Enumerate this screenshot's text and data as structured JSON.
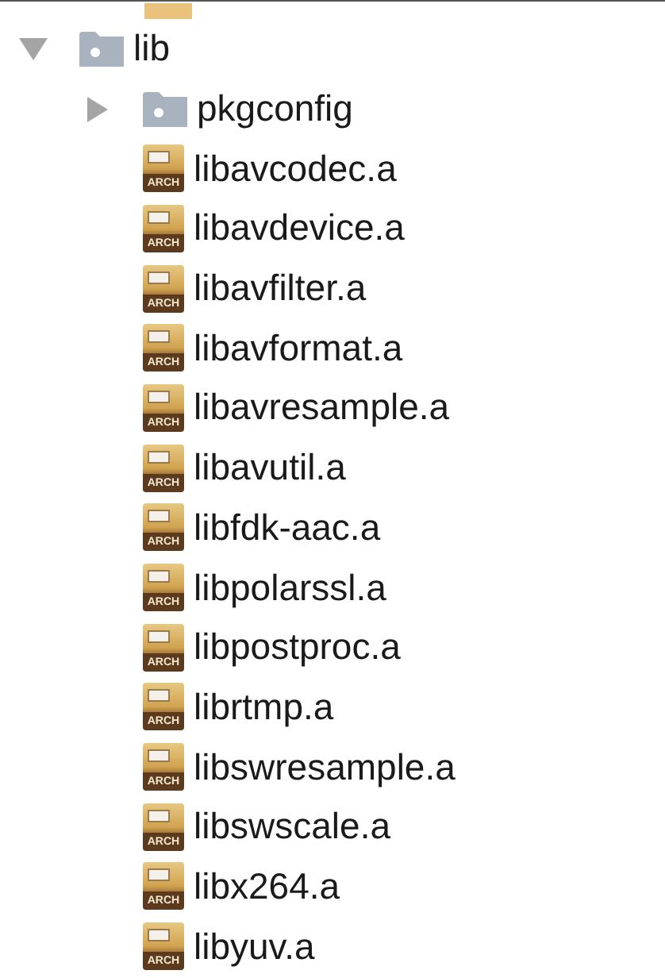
{
  "tree": [
    {
      "kind": "folder",
      "label": "lib",
      "expanded": true,
      "children": [
        {
          "kind": "folder",
          "label": "pkgconfig",
          "expanded": false
        },
        {
          "kind": "file",
          "label": "libavcodec.a",
          "icon_text": "ARCH"
        },
        {
          "kind": "file",
          "label": "libavdevice.a",
          "icon_text": "ARCH"
        },
        {
          "kind": "file",
          "label": "libavfilter.a",
          "icon_text": "ARCH"
        },
        {
          "kind": "file",
          "label": "libavformat.a",
          "icon_text": "ARCH"
        },
        {
          "kind": "file",
          "label": "libavresample.a",
          "icon_text": "ARCH"
        },
        {
          "kind": "file",
          "label": "libavutil.a",
          "icon_text": "ARCH"
        },
        {
          "kind": "file",
          "label": "libfdk-aac.a",
          "icon_text": "ARCH"
        },
        {
          "kind": "file",
          "label": "libpolarssl.a",
          "icon_text": "ARCH"
        },
        {
          "kind": "file",
          "label": "libpostproc.a",
          "icon_text": "ARCH"
        },
        {
          "kind": "file",
          "label": "librtmp.a",
          "icon_text": "ARCH"
        },
        {
          "kind": "file",
          "label": "libswresample.a",
          "icon_text": "ARCH"
        },
        {
          "kind": "file",
          "label": "libswscale.a",
          "icon_text": "ARCH"
        },
        {
          "kind": "file",
          "label": "libx264.a",
          "icon_text": "ARCH"
        },
        {
          "kind": "file",
          "label": "libyuv.a",
          "icon_text": "ARCH"
        }
      ]
    }
  ]
}
